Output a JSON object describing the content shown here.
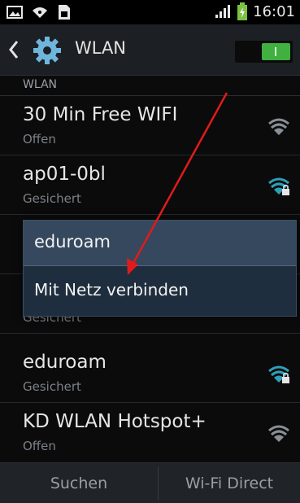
{
  "status_bar": {
    "time": "16:01",
    "icons": [
      "image-icon",
      "wifi-status-icon",
      "sim-icon",
      "signal-icon",
      "battery-icon"
    ]
  },
  "action_bar": {
    "title": "WLAN",
    "icons": [
      "back-icon",
      "settings-gear-icon"
    ],
    "toggle_on": true,
    "toggle_color": "#40b040"
  },
  "section_header": "WLAN",
  "networks": [
    {
      "name": "30 Min Free WIFI",
      "status": "Offen",
      "locked": false,
      "icon_color": "#8a8f95"
    },
    {
      "name": "ap01-0bl",
      "status": "Gesichert",
      "locked": true,
      "icon_color": "#2e9fb8"
    },
    {
      "name": "eduroam",
      "status": "",
      "locked": false,
      "icon_color": "#8a8f95"
    },
    {
      "name": "",
      "status": "Gesichert",
      "locked": true,
      "icon_color": "#8a8f95"
    },
    {
      "name": "eduroam",
      "status": "Gesichert",
      "locked": true,
      "icon_color": "#2e9fb8"
    },
    {
      "name": "KD WLAN Hotspot+",
      "status": "Offen",
      "locked": false,
      "icon_color": "#8a8f95"
    }
  ],
  "context_menu": {
    "title": "eduroam",
    "item": "Mit Netz verbinden"
  },
  "bottom_bar": {
    "left": "Suchen",
    "right": "Wi-Fi Direct"
  },
  "annotation_arrow_color": "#e01b1b"
}
